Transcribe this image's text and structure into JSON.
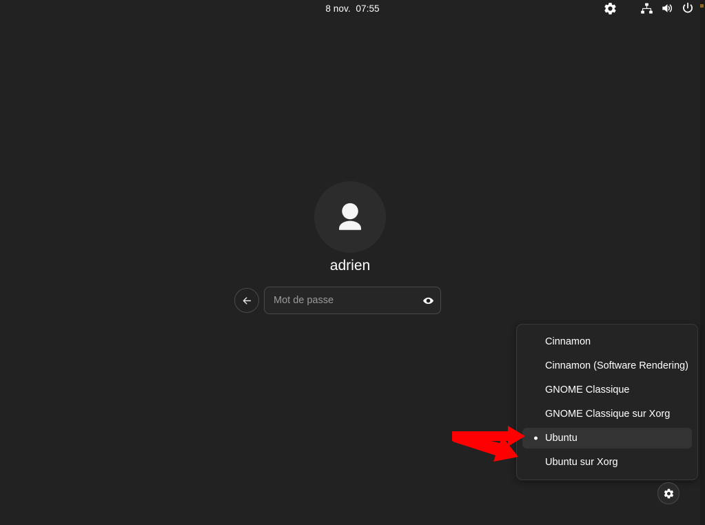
{
  "screen": {
    "background_color": "#222222",
    "kind": "gdm-login-greeter"
  },
  "top_bar": {
    "clock": "8 nov.  07:55",
    "tray": [
      {
        "name": "settings-icon",
        "label": "Paramètres d'accessibilité"
      },
      {
        "name": "network-wired-icon",
        "label": "Réseau filaire"
      },
      {
        "name": "volume-icon",
        "label": "Volume"
      },
      {
        "name": "power-icon",
        "label": "Marche/Arrêt"
      }
    ]
  },
  "login": {
    "avatar_icon": "user-avatar-icon",
    "username": "adrien",
    "back_button_icon": "arrow-left-icon",
    "password": {
      "value": "",
      "placeholder": "Mot de passe",
      "reveal_icon": "eye-icon"
    }
  },
  "session_menu": {
    "visible": true,
    "selected": "Ubuntu",
    "items": [
      {
        "label": "Cinnamon",
        "selected": false
      },
      {
        "label": "Cinnamon (Software Rendering)",
        "selected": false
      },
      {
        "label": "GNOME Classique",
        "selected": false
      },
      {
        "label": "GNOME Classique sur Xorg",
        "selected": false
      },
      {
        "label": "Ubuntu",
        "selected": true
      },
      {
        "label": "Ubuntu sur Xorg",
        "selected": false
      }
    ],
    "highlight_color": "#333333"
  },
  "session_button": {
    "icon": "gear-icon",
    "label": "Choisir la session"
  },
  "annotation": {
    "color": "#ff0000",
    "arrows": [
      {
        "name": "arrow-horizontal",
        "points_to": "Ubuntu"
      },
      {
        "name": "arrow-diagonal",
        "points_to": "Ubuntu"
      }
    ]
  }
}
